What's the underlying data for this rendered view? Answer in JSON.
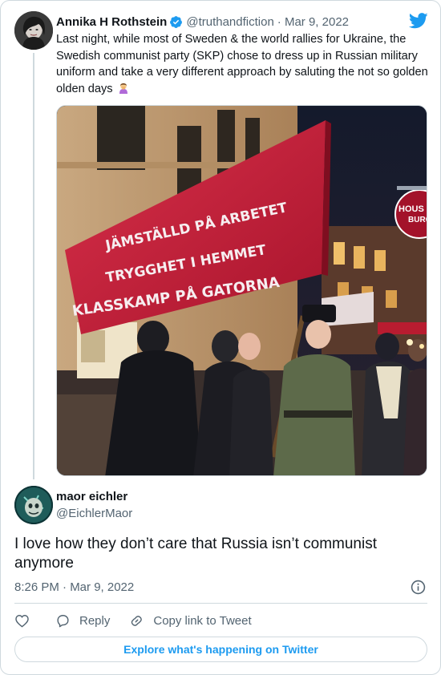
{
  "parent_tweet": {
    "author_name": "Annika H Rothstein",
    "author_handle": "@truthandfiction",
    "date": "· Mar 9, 2022",
    "text": "Last night, while most of Sweden & the world rallies for Ukraine, the Swedish communist party (SKP) chose to dress up in Russian military uniform and take a very different approach by saluting the not so golden olden days",
    "emoji": "woman-facepalming-emoji",
    "media": {
      "banner_lines": [
        "JÄMSTÄLLD PÅ ARBETET",
        "TRYGGHET I HEMMET",
        "KLASSKAMP PÅ GATORNA"
      ],
      "sign_text": [
        "HOUS",
        "BURG"
      ]
    }
  },
  "reply_tweet": {
    "author_name": "maor eichler",
    "author_handle": "@EichlerMaor",
    "text": "I love how they don’t care that Russia isn’t communist anymore",
    "timestamp": "8:26 PM · Mar 9, 2022"
  },
  "actions": {
    "reply_label": "Reply",
    "copy_link_label": "Copy link to Tweet"
  },
  "explore_label": "Explore what's happening on Twitter",
  "colors": {
    "accent": "#1d9bf0",
    "text_primary": "#0f1419",
    "text_secondary": "#536471",
    "border": "#cfd9de",
    "banner_red": "#c21f3a"
  }
}
